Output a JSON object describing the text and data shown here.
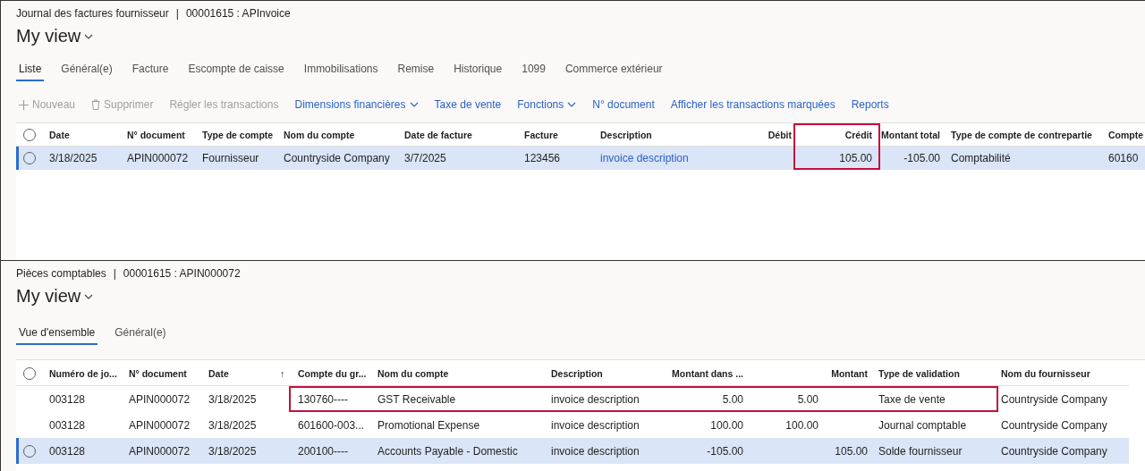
{
  "panels": [
    {
      "breadcrumb": {
        "page": "Journal des factures fournisseur",
        "separator": "|",
        "record": "00001615 : APInvoice"
      },
      "view_title": "My view",
      "tabs": [
        {
          "label": "Liste",
          "selected": true
        },
        {
          "label": "Général(e)",
          "selected": false
        },
        {
          "label": "Facture",
          "selected": false
        },
        {
          "label": "Escompte de caisse",
          "selected": false
        },
        {
          "label": "Immobilisations",
          "selected": false
        },
        {
          "label": "Remise",
          "selected": false
        },
        {
          "label": "Historique",
          "selected": false
        },
        {
          "label": "1099",
          "selected": false
        },
        {
          "label": "Commerce extérieur",
          "selected": false
        }
      ],
      "toolbar": [
        {
          "label": "Nouveau",
          "kind": "add",
          "disabled": true
        },
        {
          "label": "Supprimer",
          "kind": "delete",
          "disabled": true
        },
        {
          "label": "Régler les transactions",
          "kind": "plain",
          "disabled": true
        },
        {
          "label": "Dimensions financières",
          "kind": "menu",
          "disabled": false
        },
        {
          "label": "Taxe de vente",
          "kind": "plain",
          "disabled": false
        },
        {
          "label": "Fonctions",
          "kind": "menu",
          "disabled": false
        },
        {
          "label": "N° document",
          "kind": "plain",
          "disabled": false
        },
        {
          "label": "Afficher les transactions marquées",
          "kind": "plain",
          "disabled": false
        },
        {
          "label": "Reports",
          "kind": "plain",
          "disabled": false
        }
      ],
      "table": {
        "select_all": {
          "checked": false
        },
        "columns": [
          {
            "header": "Date",
            "kind": "text",
            "marked": false
          },
          {
            "header": "N° document",
            "kind": "text",
            "marked": false
          },
          {
            "header": "Type de compte",
            "kind": "text",
            "marked": false
          },
          {
            "header": "Nom du compte",
            "kind": "text",
            "marked": false
          },
          {
            "header": "Date de facture",
            "kind": "text",
            "marked": false
          },
          {
            "header": "Facture",
            "kind": "text",
            "marked": false
          },
          {
            "header": "Description",
            "kind": "link",
            "marked": false
          },
          {
            "header": "Débit",
            "kind": "amount",
            "marked": false
          },
          {
            "header": "Crédit",
            "kind": "amount",
            "marked": true
          },
          {
            "header": "Montant total",
            "kind": "amount",
            "marked": false
          },
          {
            "header": "Type de compte de contrepartie",
            "kind": "text",
            "marked": false
          },
          {
            "header": "Compte",
            "kind": "text",
            "marked": false
          }
        ],
        "rows": [
          {
            "selected": true,
            "cells": [
              "3/18/2025",
              "APIN000072",
              "Fournisseur",
              "Countryside Company",
              "3/7/2025",
              "123456",
              "invoice description",
              null,
              "105.00",
              "-105.00",
              "Comptabilité",
              "60160"
            ]
          }
        ]
      }
    },
    {
      "breadcrumb": {
        "page": "Pièces comptables",
        "separator": "|",
        "record": "00001615 : APIN000072"
      },
      "view_title": "My view",
      "tabs": [
        {
          "label": "Vue d'ensemble",
          "selected": true
        },
        {
          "label": "Général(e)",
          "selected": false
        }
      ],
      "table": {
        "select_all": {
          "checked": false
        },
        "columns": [
          {
            "header": "Numéro de jo...",
            "kind": "text"
          },
          {
            "header": "N° document",
            "kind": "text"
          },
          {
            "header": "Date",
            "kind": "text"
          },
          {
            "header": "↑",
            "kind": "text"
          },
          {
            "header": "Compte du gr...",
            "kind": "text"
          },
          {
            "header": "Nom du compte",
            "kind": "text"
          },
          {
            "header": "Description",
            "kind": "text"
          },
          {
            "header": "Montant dans ...",
            "kind": "amount"
          },
          {
            "kind": "amount"
          },
          {
            "header": "Montant",
            "kind": "amount"
          },
          {
            "header": "Type de validation",
            "kind": "text"
          },
          {
            "header": "Nom du fournisseur",
            "kind": "text"
          }
        ],
        "rows": [
          {
            "selected": false,
            "marked": true,
            "cells": [
              "003128",
              "APIN000072",
              "3/18/2025",
              null,
              "130760----",
              "GST Receivable",
              "invoice description",
              "5.00",
              "5.00",
              null,
              "Taxe de vente",
              "Countryside Company"
            ]
          },
          {
            "selected": false,
            "marked": false,
            "cells": [
              "003128",
              "APIN000072",
              "3/18/2025",
              null,
              "601600-003...",
              "Promotional Expense",
              "invoice description",
              "100.00",
              "100.00",
              null,
              "Journal comptable",
              "Countryside Company"
            ]
          },
          {
            "selected": true,
            "marked": false,
            "cells": [
              "003128",
              "APIN000072",
              "3/18/2025",
              null,
              "200100----",
              "Accounts Payable - Domestic",
              "invoice description",
              "-105.00",
              null,
              "105.00",
              "Solde fournisseur",
              "Countryside Company"
            ]
          }
        ]
      }
    }
  ]
}
